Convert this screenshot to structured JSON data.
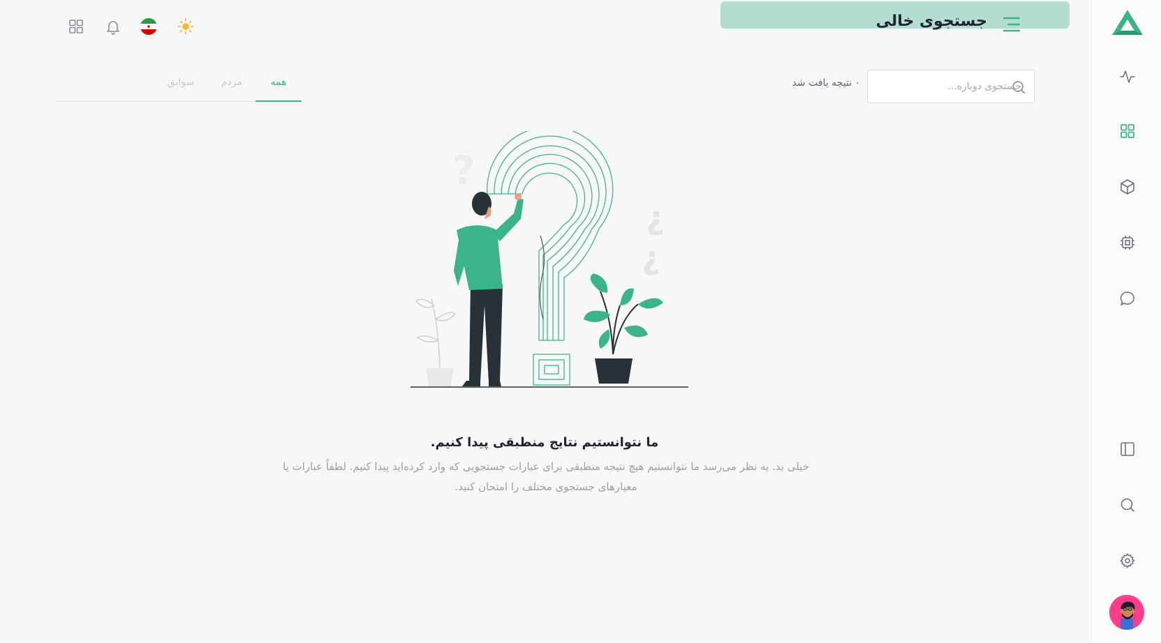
{
  "header": {
    "title": "جستجوی خالی"
  },
  "search": {
    "placeholder": "جستجوی دوباره...",
    "value": "",
    "result_count": "۰ نتیجه یافت شد"
  },
  "tabs": [
    {
      "label": "همه",
      "active": true
    },
    {
      "label": "مردم",
      "active": false
    },
    {
      "label": "سوابق",
      "active": false
    }
  ],
  "empty_state": {
    "title": "ما نتوانستیم نتایج منطبقی پیدا کنیم.",
    "description": "خیلی بد. به نظر می‌رسد ما نتوانستیم هیچ نتیجه منطبقی برای عبارات جستجویی که وارد کرده‌اید پیدا کنیم. لطفاً عبارات یا معیارهای جستجوی مختلف را امتحان کنید."
  },
  "sidebar": {
    "icons": [
      "activity-icon",
      "dashboard-grid-icon",
      "box-icon",
      "cpu-chip-icon",
      "chat-bubble-icon",
      "panel-layout-icon",
      "search-icon",
      "settings-gear-icon"
    ],
    "active": "dashboard-grid-icon"
  },
  "topbar": {
    "icons": [
      "theme-sun-icon",
      "flag-iran-icon",
      "notification-bell-icon",
      "apps-grid-icon"
    ]
  },
  "colors": {
    "accent": "#3bb48a",
    "title_pill": "#b3ddd0",
    "sun": "#f5b731",
    "avatar_bg": "#ff3d8b"
  }
}
